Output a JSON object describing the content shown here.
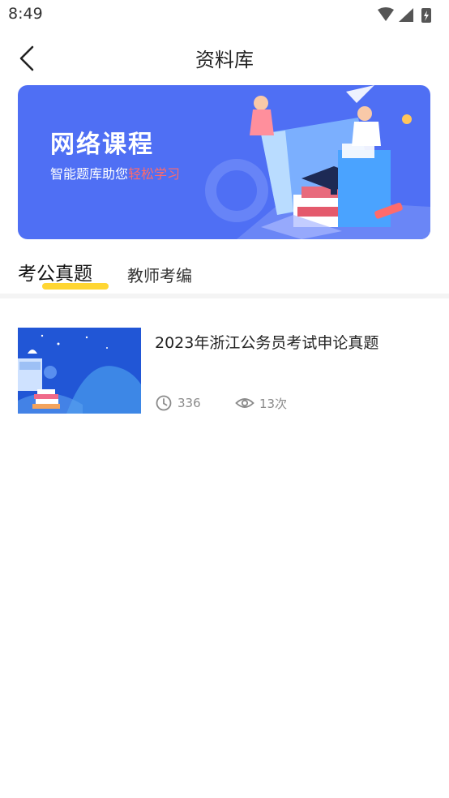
{
  "status_bar": {
    "time": "8:49"
  },
  "header": {
    "title": "资料库"
  },
  "banner": {
    "title": "网络课程",
    "subtitle_prefix": "智能题库助您",
    "subtitle_highlight": "轻松学习"
  },
  "tabs": [
    {
      "label": "考公真题",
      "active": true
    },
    {
      "label": "教师考编",
      "active": false
    }
  ],
  "items": [
    {
      "title": "2023年浙江公务员考试申论真题",
      "duration": "336",
      "views": "13次"
    }
  ],
  "colors": {
    "banner_bg": "#4f6ff4",
    "active_tab_underline": "#ffd633",
    "highlight": "#ff6a6a"
  }
}
